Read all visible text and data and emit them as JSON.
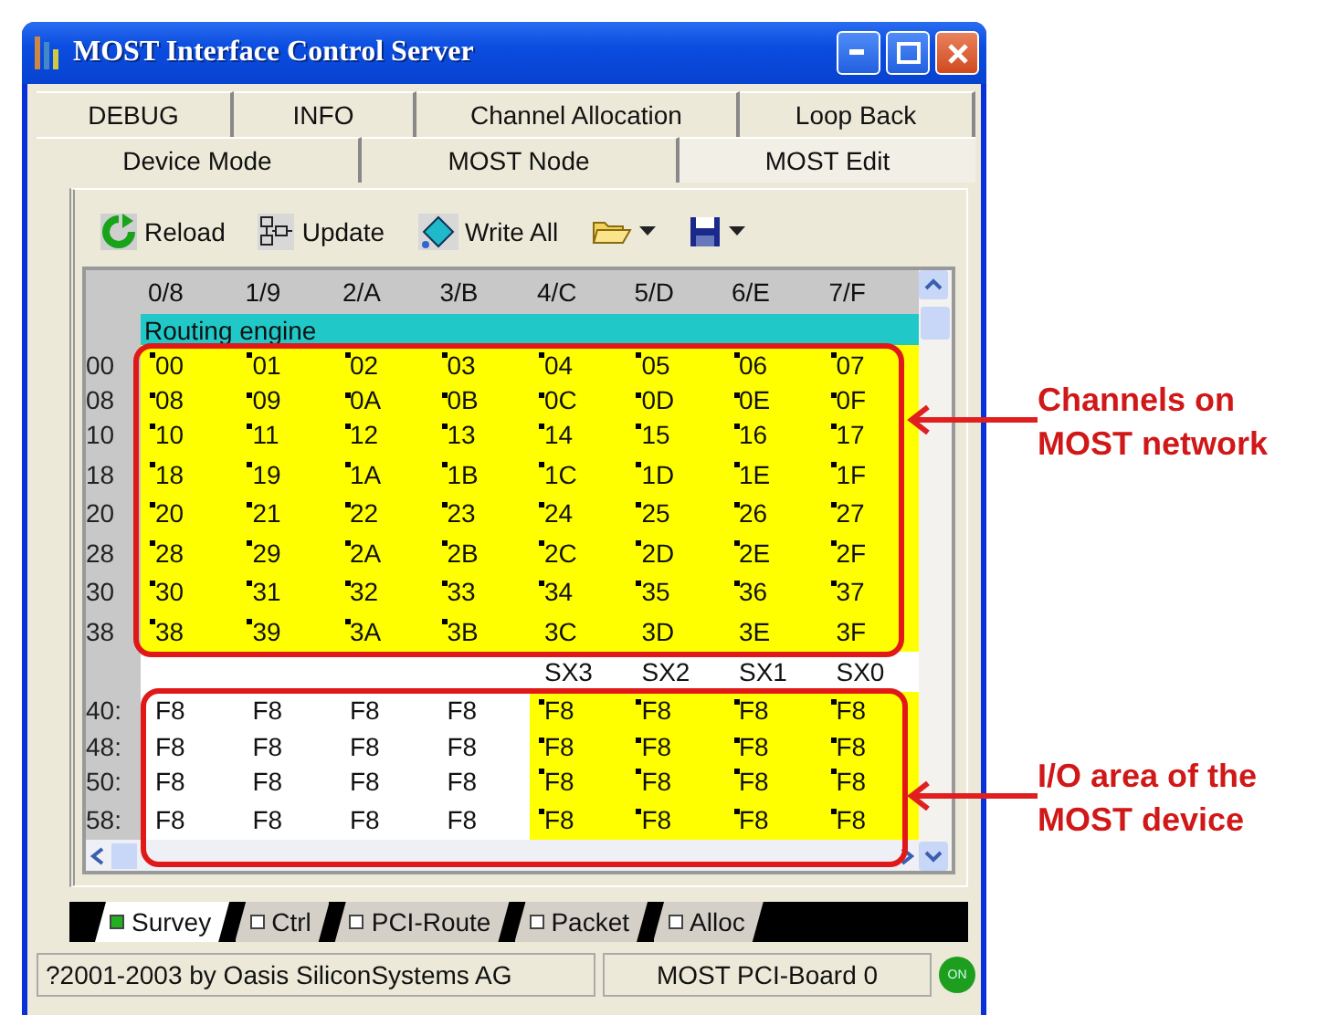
{
  "window": {
    "title": "MOST Interface Control Server"
  },
  "tabs_row_1": [
    {
      "label": "DEBUG",
      "selected": false
    },
    {
      "label": "INFO",
      "selected": false
    },
    {
      "label": "Channel Allocation",
      "selected": false
    },
    {
      "label": "Loop Back",
      "selected": false
    }
  ],
  "tabs_row_2": [
    {
      "label": "Device Mode",
      "selected": false
    },
    {
      "label": "MOST Node",
      "selected": false
    },
    {
      "label": "MOST Edit",
      "selected": true
    }
  ],
  "toolbar": [
    {
      "kind": "reload",
      "label": "Reload"
    },
    {
      "kind": "update",
      "label": "Update"
    },
    {
      "kind": "write",
      "label": "Write All"
    },
    {
      "kind": "open"
    },
    {
      "kind": "save"
    }
  ],
  "grid": {
    "columns": [
      "0/8",
      "1/9",
      "2/A",
      "3/B",
      "4/C",
      "5/D",
      "6/E",
      "7/F"
    ],
    "section_label": "Routing engine",
    "rows": [
      {
        "label": "00",
        "cells": [
          {
            "text": "00",
            "marked": true,
            "highlighted": true
          },
          {
            "text": "01",
            "marked": true,
            "highlighted": true
          },
          {
            "text": "02",
            "marked": true,
            "highlighted": true
          },
          {
            "text": "03",
            "marked": true,
            "highlighted": true
          },
          {
            "text": "04",
            "marked": true,
            "highlighted": true
          },
          {
            "text": "05",
            "marked": true,
            "highlighted": true
          },
          {
            "text": "06",
            "marked": true,
            "highlighted": true
          },
          {
            "text": "07",
            "marked": true,
            "highlighted": true
          }
        ]
      },
      {
        "label": "08",
        "cells": [
          {
            "text": "08",
            "marked": true,
            "highlighted": true
          },
          {
            "text": "09",
            "marked": true,
            "highlighted": true
          },
          {
            "text": "0A",
            "marked": true,
            "highlighted": true
          },
          {
            "text": "0B",
            "marked": true,
            "highlighted": true
          },
          {
            "text": "0C",
            "marked": true,
            "highlighted": true
          },
          {
            "text": "0D",
            "marked": true,
            "highlighted": true
          },
          {
            "text": "0E",
            "marked": true,
            "highlighted": true
          },
          {
            "text": "0F",
            "marked": true,
            "highlighted": true
          }
        ]
      },
      {
        "label": "10",
        "cells": [
          {
            "text": "10",
            "marked": true,
            "highlighted": true
          },
          {
            "text": "11",
            "marked": true,
            "highlighted": true
          },
          {
            "text": "12",
            "marked": true,
            "highlighted": true
          },
          {
            "text": "13",
            "marked": true,
            "highlighted": true
          },
          {
            "text": "14",
            "marked": true,
            "highlighted": true
          },
          {
            "text": "15",
            "marked": true,
            "highlighted": true
          },
          {
            "text": "16",
            "marked": true,
            "highlighted": true
          },
          {
            "text": "17",
            "marked": true,
            "highlighted": true
          }
        ]
      },
      {
        "label": "18",
        "cells": [
          {
            "text": "18",
            "marked": true,
            "highlighted": true
          },
          {
            "text": "19",
            "marked": true,
            "highlighted": true
          },
          {
            "text": "1A",
            "marked": true,
            "highlighted": true
          },
          {
            "text": "1B",
            "marked": true,
            "highlighted": true
          },
          {
            "text": "1C",
            "marked": true,
            "highlighted": true
          },
          {
            "text": "1D",
            "marked": true,
            "highlighted": true
          },
          {
            "text": "1E",
            "marked": true,
            "highlighted": true
          },
          {
            "text": "1F",
            "marked": true,
            "highlighted": true
          }
        ]
      },
      {
        "label": "20",
        "cells": [
          {
            "text": "20",
            "marked": true,
            "highlighted": true
          },
          {
            "text": "21",
            "marked": true,
            "highlighted": true
          },
          {
            "text": "22",
            "marked": true,
            "highlighted": true
          },
          {
            "text": "23",
            "marked": true,
            "highlighted": true
          },
          {
            "text": "24",
            "marked": true,
            "highlighted": true
          },
          {
            "text": "25",
            "marked": true,
            "highlighted": true
          },
          {
            "text": "26",
            "marked": true,
            "highlighted": true
          },
          {
            "text": "27",
            "marked": true,
            "highlighted": true
          }
        ]
      },
      {
        "label": "28",
        "cells": [
          {
            "text": "28",
            "marked": true,
            "highlighted": true
          },
          {
            "text": "29",
            "marked": true,
            "highlighted": true
          },
          {
            "text": "2A",
            "marked": true,
            "highlighted": true
          },
          {
            "text": "2B",
            "marked": true,
            "highlighted": true
          },
          {
            "text": "2C",
            "marked": true,
            "highlighted": true
          },
          {
            "text": "2D",
            "marked": true,
            "highlighted": true
          },
          {
            "text": "2E",
            "marked": true,
            "highlighted": true
          },
          {
            "text": "2F",
            "marked": true,
            "highlighted": true
          }
        ]
      },
      {
        "label": "30",
        "cells": [
          {
            "text": "30",
            "marked": true,
            "highlighted": true
          },
          {
            "text": "31",
            "marked": true,
            "highlighted": true
          },
          {
            "text": "32",
            "marked": true,
            "highlighted": true
          },
          {
            "text": "33",
            "marked": true,
            "highlighted": true
          },
          {
            "text": "34",
            "marked": true,
            "highlighted": true
          },
          {
            "text": "35",
            "marked": true,
            "highlighted": true
          },
          {
            "text": "36",
            "marked": true,
            "highlighted": true
          },
          {
            "text": "37",
            "marked": true,
            "highlighted": true
          }
        ]
      },
      {
        "label": "38",
        "cells": [
          {
            "text": "38",
            "marked": true,
            "highlighted": true
          },
          {
            "text": "39",
            "marked": true,
            "highlighted": true
          },
          {
            "text": "3A",
            "marked": true,
            "highlighted": true
          },
          {
            "text": "3B",
            "marked": true,
            "highlighted": true
          },
          {
            "text": "3C",
            "marked": false,
            "highlighted": true
          },
          {
            "text": "3D",
            "marked": false,
            "highlighted": true
          },
          {
            "text": "3E",
            "marked": false,
            "highlighted": true
          },
          {
            "text": "3F",
            "marked": false,
            "highlighted": true
          }
        ]
      }
    ],
    "sub_columns": [
      "SX3",
      "SX2",
      "SX1",
      "SX0"
    ],
    "io_rows": [
      {
        "label": "40:",
        "cells": [
          {
            "text": "F8",
            "marked": false,
            "highlighted": false
          },
          {
            "text": "F8",
            "marked": false,
            "highlighted": false
          },
          {
            "text": "F8",
            "marked": false,
            "highlighted": false
          },
          {
            "text": "F8",
            "marked": false,
            "highlighted": false
          },
          {
            "text": "F8",
            "marked": true,
            "highlighted": true
          },
          {
            "text": "F8",
            "marked": true,
            "highlighted": true
          },
          {
            "text": "F8",
            "marked": true,
            "highlighted": true
          },
          {
            "text": "F8",
            "marked": true,
            "highlighted": true
          }
        ]
      },
      {
        "label": "48:",
        "cells": [
          {
            "text": "F8",
            "marked": false,
            "highlighted": false
          },
          {
            "text": "F8",
            "marked": false,
            "highlighted": false
          },
          {
            "text": "F8",
            "marked": false,
            "highlighted": false
          },
          {
            "text": "F8",
            "marked": false,
            "highlighted": false
          },
          {
            "text": "F8",
            "marked": true,
            "highlighted": true
          },
          {
            "text": "F8",
            "marked": true,
            "highlighted": true
          },
          {
            "text": "F8",
            "marked": true,
            "highlighted": true
          },
          {
            "text": "F8",
            "marked": true,
            "highlighted": true
          }
        ]
      },
      {
        "label": "50:",
        "cells": [
          {
            "text": "F8",
            "marked": false,
            "highlighted": false
          },
          {
            "text": "F8",
            "marked": false,
            "highlighted": false
          },
          {
            "text": "F8",
            "marked": false,
            "highlighted": false
          },
          {
            "text": "F8",
            "marked": false,
            "highlighted": false
          },
          {
            "text": "F8",
            "marked": true,
            "highlighted": true
          },
          {
            "text": "F8",
            "marked": true,
            "highlighted": true
          },
          {
            "text": "F8",
            "marked": true,
            "highlighted": true
          },
          {
            "text": "F8",
            "marked": true,
            "highlighted": true
          }
        ]
      },
      {
        "label": "58:",
        "cells": [
          {
            "text": "F8",
            "marked": false,
            "highlighted": false
          },
          {
            "text": "F8",
            "marked": false,
            "highlighted": false
          },
          {
            "text": "F8",
            "marked": false,
            "highlighted": false
          },
          {
            "text": "F8",
            "marked": false,
            "highlighted": false
          },
          {
            "text": "F8",
            "marked": true,
            "highlighted": true
          },
          {
            "text": "F8",
            "marked": true,
            "highlighted": true
          },
          {
            "text": "F8",
            "marked": true,
            "highlighted": true
          },
          {
            "text": "F8",
            "marked": true,
            "highlighted": true
          }
        ]
      }
    ]
  },
  "bottom_tabs": [
    {
      "label": "Survey",
      "selected": true
    },
    {
      "label": "Ctrl",
      "selected": false
    },
    {
      "label": "PCI-Route",
      "selected": false
    },
    {
      "label": "Packet",
      "selected": false
    },
    {
      "label": "Alloc",
      "selected": false
    }
  ],
  "status_bar": {
    "copyright": "?2001-2003 by Oasis SiliconSystems AG",
    "device": "MOST PCI-Board 0",
    "indicator": "ON"
  },
  "annotations": [
    {
      "text": "Channels on\nMOST network"
    },
    {
      "text": "I/O area of the\nMOST device"
    }
  ]
}
